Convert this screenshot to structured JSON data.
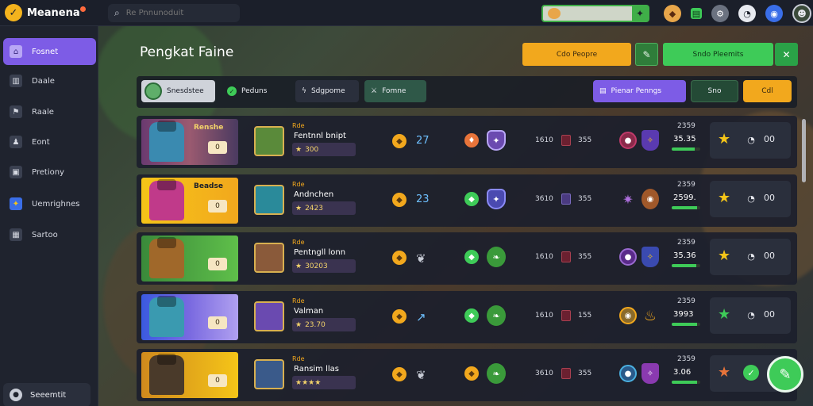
{
  "app": {
    "name": "Meanena",
    "search_placeholder": "Re Pnnunoduit"
  },
  "topbar": {
    "icons": [
      "chest-icon",
      "inventory-icon",
      "settings-icon",
      "timer-icon",
      "compass-icon",
      "profile-avatar"
    ]
  },
  "sidebar": {
    "items": [
      {
        "label": "Fosnet",
        "icon": "home-icon"
      },
      {
        "label": "Daale",
        "icon": "book-icon"
      },
      {
        "label": "Raale",
        "icon": "flag-icon"
      },
      {
        "label": "Eont",
        "icon": "person-icon"
      },
      {
        "label": "Pretiony",
        "icon": "card-icon"
      },
      {
        "label": "Uemrighnes",
        "icon": "gems-icon"
      },
      {
        "label": "Sartoo",
        "icon": "clipboard-icon"
      }
    ],
    "bottom_label": "Seeemtit"
  },
  "header": {
    "title": "Pengkat Faine",
    "btn_yellow": "Cdo Peopre",
    "btn_green": "Sndo Pleemits"
  },
  "filters": {
    "chip1": "Snesdstee",
    "chip2": "Peduns",
    "chip3": "Sdgpome",
    "chip4": "Fomne",
    "chip5": "Pienar Penngs",
    "chip6": "Sno",
    "chip7": "Cdl"
  },
  "rows": [
    {
      "hero_tag": "Renshe",
      "hero_lvl": "0",
      "rank": "Rde",
      "name": "Fentnnl bnipt",
      "score": "300",
      "val1": "27",
      "num1": "1610",
      "num2": "355",
      "stat_top": "2359",
      "stat_val": "35.35",
      "progress": 0.8,
      "act": "00"
    },
    {
      "hero_tag": "Beadse",
      "hero_lvl": "0",
      "rank": "Rde",
      "name": "Andnchen",
      "score": "2423",
      "val1": "23",
      "num1": "3610",
      "num2": "355",
      "stat_top": "2359",
      "stat_val": "2599.",
      "progress": 0.9,
      "act": "00"
    },
    {
      "hero_tag": "",
      "hero_lvl": "0",
      "rank": "Rde",
      "name": "Pentngll lonn",
      "score": "30203",
      "val1": "",
      "num1": "1610",
      "num2": "355",
      "stat_top": "2359",
      "stat_val": "35.36",
      "progress": 0.85,
      "act": "00"
    },
    {
      "hero_tag": "",
      "hero_lvl": "0",
      "rank": "Rde",
      "name": "Valman",
      "score": "23.70",
      "val1": "",
      "num1": "1610",
      "num2": "155",
      "stat_top": "2359",
      "stat_val": "3993",
      "progress": 0.9,
      "act": "00"
    },
    {
      "hero_tag": "",
      "hero_lvl": "0",
      "rank": "Rde",
      "name": "Ransim llas",
      "score": "",
      "val1": "",
      "num1": "3610",
      "num2": "355",
      "stat_top": "2359",
      "stat_val": "3.06",
      "progress": 0.88,
      "act": ""
    }
  ],
  "colors": {
    "accent_purple": "#7d5ce6",
    "accent_green": "#3ecb58",
    "accent_yellow": "#f2a81d"
  }
}
